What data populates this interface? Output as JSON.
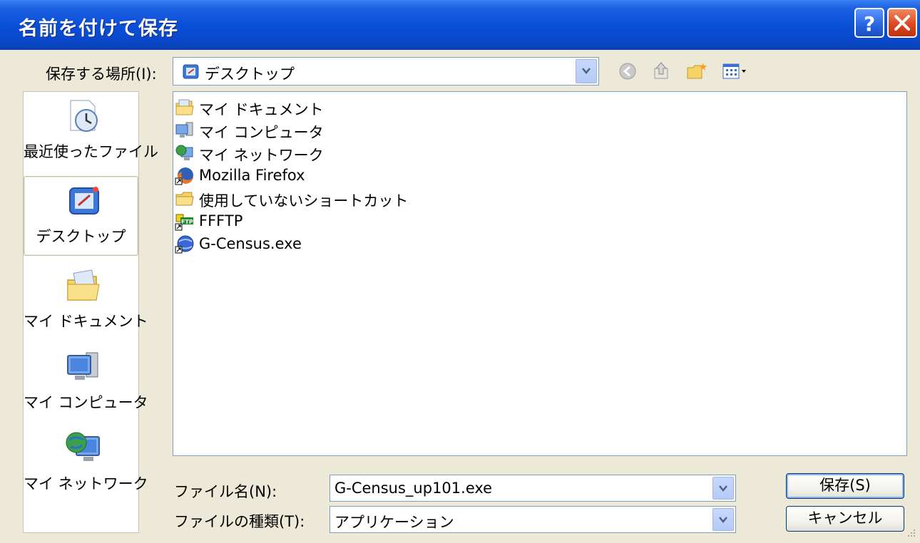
{
  "window": {
    "title": "名前を付けて保存",
    "help_icon": "help-icon",
    "close_icon": "close-icon"
  },
  "location": {
    "label": "保存する場所(I):",
    "value": "デスクトップ",
    "icon": "desktop-icon"
  },
  "toolbar": {
    "back_icon": "back-arrow-icon",
    "up_icon": "up-folder-icon",
    "new_folder_icon": "new-folder-icon",
    "view_icon": "view-menu-icon"
  },
  "places": [
    {
      "label": "最近使ったファイル",
      "icon": "recent-documents-icon"
    },
    {
      "label": "デスクトップ",
      "icon": "desktop-icon"
    },
    {
      "label": "マイ ドキュメント",
      "icon": "my-documents-icon"
    },
    {
      "label": "マイ コンピュータ",
      "icon": "my-computer-icon"
    },
    {
      "label": "マイ ネットワーク",
      "icon": "my-network-icon"
    }
  ],
  "files": [
    {
      "name": "マイ ドキュメント",
      "icon": "my-documents-icon"
    },
    {
      "name": "マイ コンピュータ",
      "icon": "my-computer-icon"
    },
    {
      "name": "マイ ネットワーク",
      "icon": "my-network-icon"
    },
    {
      "name": "Mozilla Firefox",
      "icon": "firefox-icon"
    },
    {
      "name": "使用していないショートカット",
      "icon": "folder-icon"
    },
    {
      "name": "FFFTP",
      "icon": "ffftp-icon"
    },
    {
      "name": "G-Census.exe",
      "icon": "globe-app-icon"
    }
  ],
  "filename": {
    "label": "ファイル名(N):",
    "value": "G-Census_up101.exe"
  },
  "filetype": {
    "label": "ファイルの種類(T):",
    "value": "アプリケーション"
  },
  "buttons": {
    "save": "保存(S)",
    "cancel": "キャンセル"
  },
  "colors": {
    "titlebar": "#0a4fd8",
    "dialog_bg": "#ece9d8",
    "border": "#7f9db9"
  }
}
